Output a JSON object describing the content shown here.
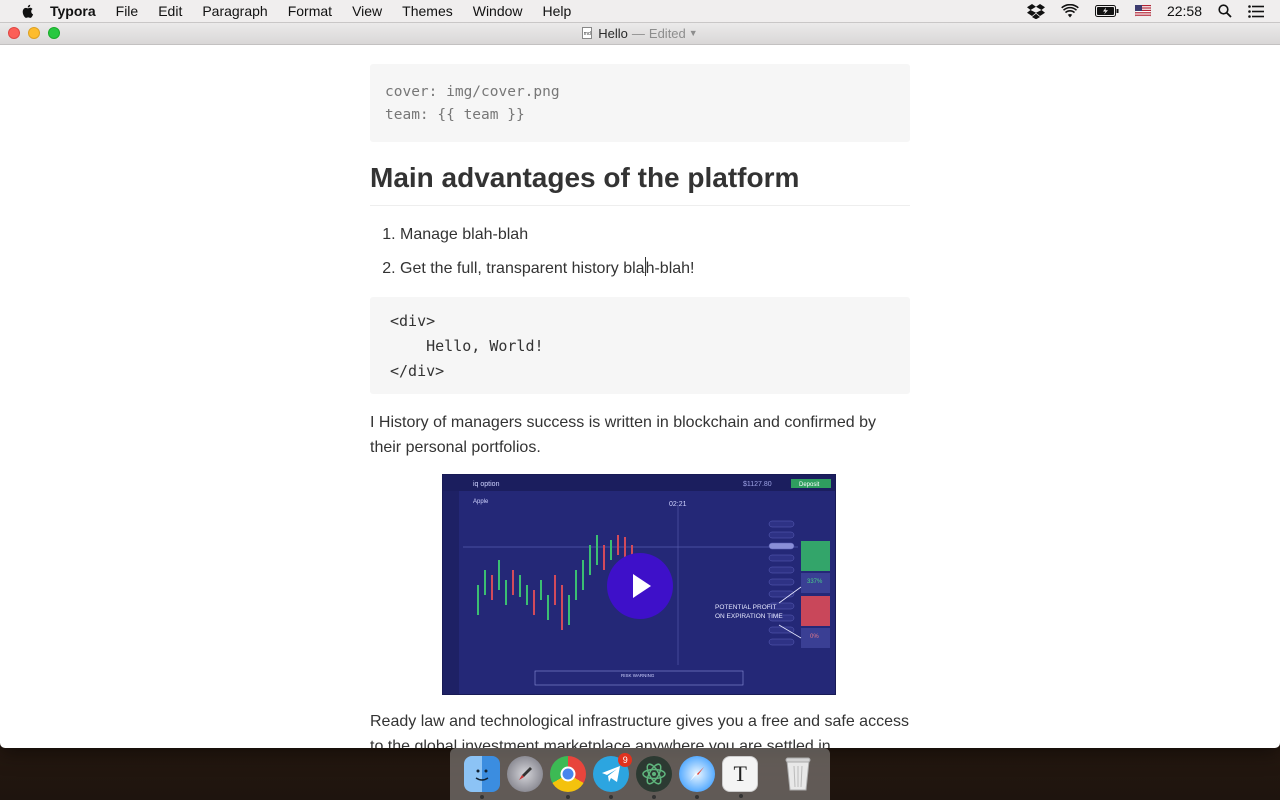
{
  "menubar": {
    "app_name": "Typora",
    "items": [
      "File",
      "Edit",
      "Paragraph",
      "Format",
      "View",
      "Themes",
      "Window",
      "Help"
    ],
    "clock": "22:58"
  },
  "window": {
    "title": "Hello",
    "separator": "—",
    "status": "Edited"
  },
  "document": {
    "front_matter": [
      "cover: img/cover.png",
      "team: {{ team }}"
    ],
    "heading": "Main advantages of the platform",
    "list": [
      "Manage blah-blah",
      {
        "before_cursor": "Get the full, transparent history bla",
        "after_cursor": "h-blah!"
      }
    ],
    "code": [
      "<div>",
      "    Hello, World!",
      "</div>"
    ],
    "paragraph1": "I History of managers success is written in blockchain and confirmed by their personal portfolios.",
    "video": {
      "brand": "iq option",
      "balance": "$1127.80",
      "deposit_label": "Deposit",
      "asset": "Apple",
      "timer": "02:21",
      "annotation_line1": "POTENTIAL PROFIT",
      "annotation_line2": "ON EXPIRATION TIME",
      "call_profit": "337%",
      "put_profit": "0%",
      "risk_warning": "RISK WARNING"
    },
    "paragraph2": "Ready law and technological infrastructure gives you a free and safe access to the global investment marketplace anywhere you are settled in."
  },
  "dock": {
    "apps": [
      "Finder",
      "Launchpad",
      "Chrome",
      "Telegram",
      "Atom",
      "Safari",
      "Typora",
      "Trash"
    ],
    "telegram_badge": "9",
    "typora_letter": "T",
    "colors": {
      "finder": "#3b8de0",
      "launchpad": "#8e8e93",
      "chrome": "#e8453c",
      "telegram": "#2ca5e0",
      "atom": "#5fb57d",
      "safari": "#1a8cff",
      "typora": "#f4f4f4",
      "trash": "#dcdcdc"
    }
  }
}
